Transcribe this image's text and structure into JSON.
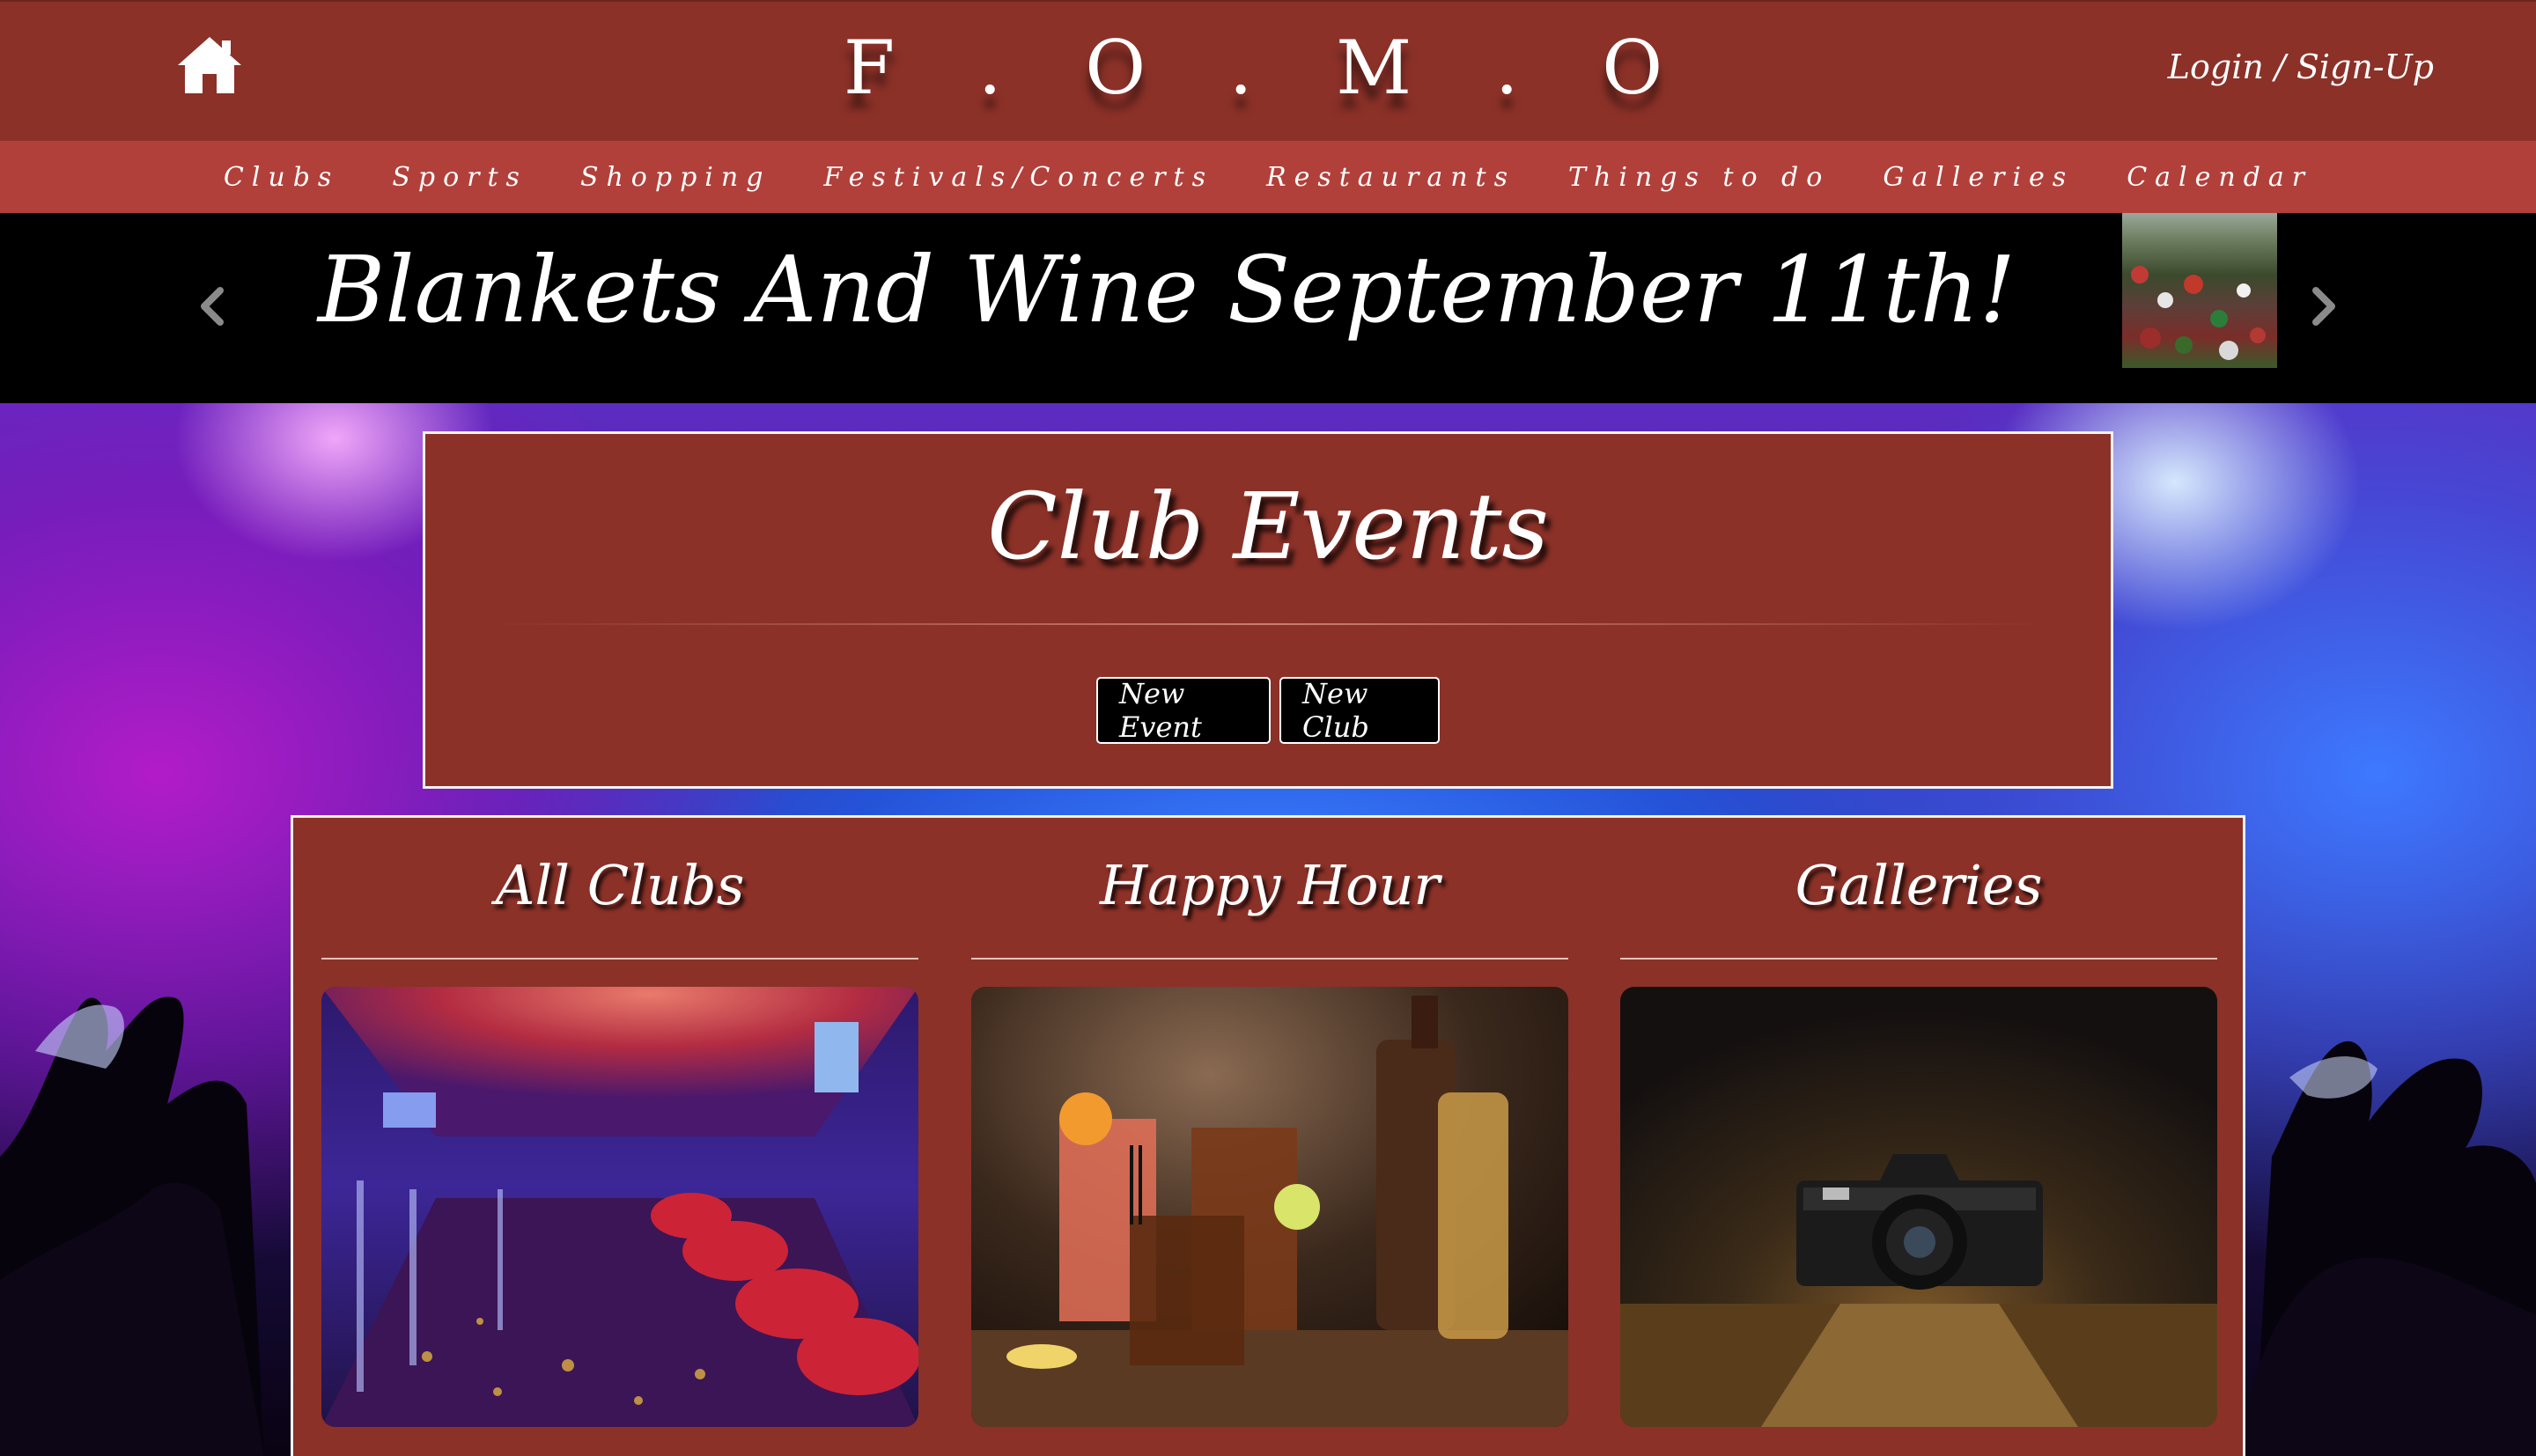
{
  "header": {
    "brand": "F . O . M . O",
    "login_label": "Login / Sign-Up",
    "home_icon": "home-icon",
    "colors": {
      "header_bg": "#8b3128",
      "nav_bg": "#b2403a"
    }
  },
  "nav": {
    "items": [
      {
        "label": "Clubs"
      },
      {
        "label": "Sports"
      },
      {
        "label": "Shopping"
      },
      {
        "label": "Festivals/Concerts"
      },
      {
        "label": "Restaurants"
      },
      {
        "label": "Things to do"
      },
      {
        "label": "Galleries"
      },
      {
        "label": "Calendar"
      }
    ]
  },
  "carousel": {
    "headline": "Blankets And Wine September 11th!",
    "prev_icon": "chevron-left-icon",
    "next_icon": "chevron-right-icon"
  },
  "events_panel": {
    "title": "Club Events",
    "new_event_label": "New Event",
    "new_club_label": "New Club"
  },
  "cards": [
    {
      "title": "All Clubs",
      "image": "club-interior-photo"
    },
    {
      "title": "Happy Hour",
      "image": "cocktails-photo"
    },
    {
      "title": "Galleries",
      "image": "camera-photo"
    }
  ]
}
